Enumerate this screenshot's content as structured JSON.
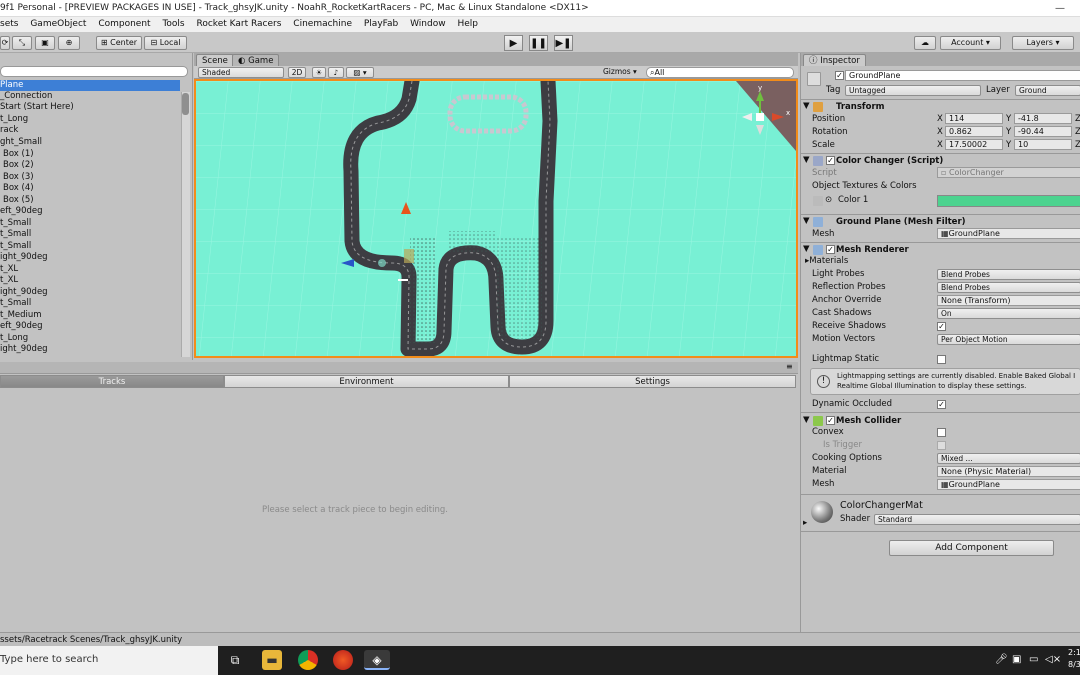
{
  "window": {
    "title": "9f1 Personal - [PREVIEW PACKAGES IN USE] - Track_ghsyJK.unity - NoahR_RocketKartRacers - PC, Mac & Linux Standalone <DX11>",
    "min": "—",
    "max": "☐",
    "close": "✕"
  },
  "menu": [
    "sets",
    "GameObject",
    "Component",
    "Tools",
    "Rocket Kart Racers",
    "Cinemachine",
    "PlayFab",
    "Window",
    "Help"
  ],
  "toolbar": {
    "pivot": "Center",
    "space": "Local",
    "account": "Account",
    "layers": "Layers",
    "play": "▶",
    "pause": "❚❚",
    "step": "▶❚"
  },
  "hierarchy": {
    "items": [
      "Plane",
      "_Connection",
      "Start (Start Here)",
      "t_Long",
      "rack",
      "ght_Small",
      "Box (1)",
      "Box (2)",
      "Box (3)",
      "Box (4)",
      "Box (5)",
      "eft_90deg",
      "t_Small",
      "t_Small",
      "t_Small",
      "ight_90deg",
      "t_XL",
      "t_XL",
      "ight_90deg",
      "t_Small",
      "t_Medium",
      "eft_90deg",
      "t_Long",
      "ight_90deg"
    ]
  },
  "scene": {
    "tab_scene": "Scene",
    "tab_game": "Game",
    "shading": "Shaded",
    "mode2d": "2D",
    "gizmos": "Gizmos",
    "search_placeholder": "All"
  },
  "trackpanel": {
    "tabs": [
      "Tracks",
      "Environment",
      "Settings"
    ],
    "message": "Please select a track piece to begin editing."
  },
  "status": {
    "path": "ssets/Racetrack Scenes/Track_ghsyJK.unity"
  },
  "inspector": {
    "tab": "Inspector",
    "object_name": "GroundPlane",
    "tag_label": "Tag",
    "tag": "Untagged",
    "layer_label": "Layer",
    "layer": "Ground",
    "transform": {
      "title": "Transform",
      "position_label": "Position",
      "rotation_label": "Rotation",
      "scale_label": "Scale",
      "px": "114",
      "py": "-41.8",
      "rx": "0.862",
      "ry": "-90.44",
      "sx": "17.50002",
      "sy": "10",
      "x": "X",
      "y": "Y",
      "z": "Z"
    },
    "color_changer": {
      "title": "Color Changer (Script)",
      "script_label": "Script",
      "script": "ColorChanger",
      "textures_label": "Object Textures & Colors",
      "color1_label": "Color 1",
      "color1": "#4cd38f"
    },
    "mesh_filter": {
      "title": "Ground Plane (Mesh Filter)",
      "mesh_label": "Mesh",
      "mesh": "GroundPlane"
    },
    "mesh_renderer": {
      "title": "Mesh Renderer",
      "materials": "Materials",
      "light_probes_label": "Light Probes",
      "light_probes": "Blend Probes",
      "reflection_label": "Reflection Probes",
      "reflection": "Blend Probes",
      "anchor_label": "Anchor Override",
      "anchor": "None (Transform)",
      "cast_label": "Cast Shadows",
      "cast": "On",
      "receive_label": "Receive Shadows",
      "motion_label": "Motion Vectors",
      "motion": "Per Object Motion",
      "lightmap_label": "Lightmap Static",
      "info_1": "Lightmapping settings are currently disabled. Enable Baked Global I",
      "info_2": "Realtime Global Illumination to display these settings.",
      "dynamic_label": "Dynamic Occluded"
    },
    "mesh_collider": {
      "title": "Mesh Collider",
      "convex_label": "Convex",
      "trigger_label": "Is Trigger",
      "cooking_label": "Cooking Options",
      "cooking": "Mixed ...",
      "material_label": "Material",
      "material": "None (Physic Material)",
      "mesh_label": "Mesh",
      "mesh": "GroundPlane"
    },
    "material": {
      "name": "ColorChangerMat",
      "shader_label": "Shader",
      "shader": "Standard"
    },
    "add_component": "Add Component"
  },
  "taskbar": {
    "search_placeholder": "Type here to search",
    "time": "2:1",
    "date": "8/3"
  },
  "colors": {
    "ground": "#78f0d4",
    "accent": "#f28c1a",
    "selected": "#3d7fd6"
  }
}
